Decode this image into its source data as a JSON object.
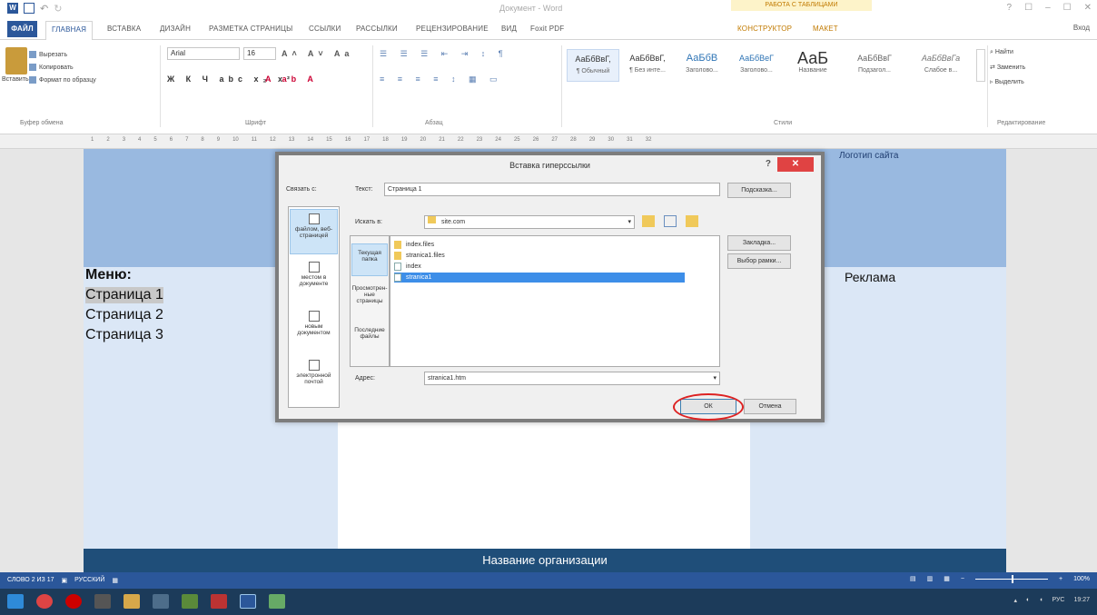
{
  "titlebar": {
    "doc_title": "Документ - Word",
    "context_label": "РАБОТА С ТАБЛИЦАМИ",
    "win_controls": [
      "?",
      "☐",
      "–",
      "☐",
      "✕"
    ]
  },
  "tabs": {
    "file": "ФАЙЛ",
    "items": [
      "ГЛАВНАЯ",
      "ВСТАВКА",
      "ДИЗАЙН",
      "РАЗМЕТКА СТРАНИЦЫ",
      "ССЫЛКИ",
      "РАССЫЛКИ",
      "РЕЦЕНЗИРОВАНИЕ",
      "ВИД",
      "Foxit PDF"
    ],
    "context_items": [
      "КОНСТРУКТОР",
      "МАКЕТ"
    ],
    "signin": "Вход"
  },
  "ribbon": {
    "paste_label": "Вставить",
    "cut": "Вырезать",
    "copy": "Копировать",
    "format_painter": "Формат по образцу",
    "clipboard_group": "Буфер обмена",
    "font_name": "Arial",
    "font_size": "16",
    "font_group": "Шрифт",
    "para_group": "Абзац",
    "styles_group": "Стили",
    "editing_group": "Редактирование",
    "styles": [
      {
        "sample": "АаБбВвГ,",
        "name": "¶ Обычный"
      },
      {
        "sample": "АаБбВвГ,",
        "name": "¶ Без инте..."
      },
      {
        "sample": "АаБбВ",
        "name": "Заголово..."
      },
      {
        "sample": "АаБбВеГ",
        "name": "Заголово..."
      },
      {
        "sample": "АаБ",
        "name": "Название"
      },
      {
        "sample": "АаБбВвГ",
        "name": "Подзагол..."
      },
      {
        "sample": "АаБбВвГа",
        "name": "Слабое в..."
      }
    ],
    "find": "Найти",
    "replace": "Заменить",
    "select": "Выделить"
  },
  "document": {
    "logo": "Логотип сайта",
    "menu_title": "Меню:",
    "menu_items": [
      "Страница 1",
      "Страница 2",
      "Страница 3"
    ],
    "ad": "Реклама",
    "footer": "Название организации"
  },
  "dialog": {
    "title": "Вставка гиперссылки",
    "help": "?",
    "link_to_label": "Связать с:",
    "text_label": "Текст:",
    "text_value": "Страница 1",
    "tooltip_button": "Подсказка...",
    "look_in_label": "Искать в:",
    "look_in_value": "site.com",
    "link_options": [
      {
        "label": "файлом, веб-страницей"
      },
      {
        "label": "местом в документе"
      },
      {
        "label": "новым документом"
      },
      {
        "label": "электронной почтой"
      }
    ],
    "side_tabs": [
      "Текущая папка",
      "Просмотрен-ные страницы",
      "Последние файлы"
    ],
    "files": [
      "index.files",
      "stranica1.files",
      "index",
      "stranica1"
    ],
    "bookmark_button": "Закладка...",
    "target_frame_button": "Выбор рамки...",
    "address_label": "Адрес:",
    "address_value": "stranica1.htm",
    "ok": "ОК",
    "cancel": "Отмена"
  },
  "statusbar": {
    "words": "СЛОВО 2 ИЗ 17",
    "language": "РУССКИЙ",
    "zoom": "100%"
  },
  "taskbar": {
    "lang": "РУС",
    "time": "19:27"
  }
}
